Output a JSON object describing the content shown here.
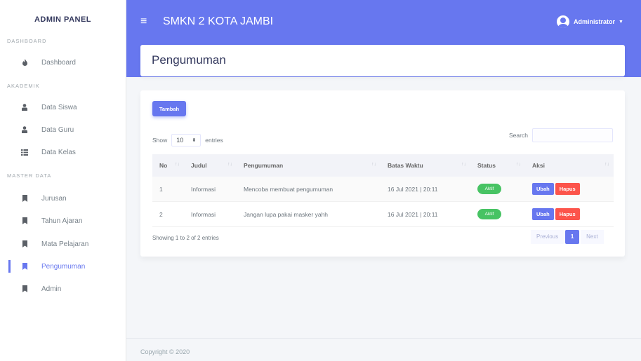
{
  "sidebar": {
    "brand": "ADMIN PANEL",
    "sections": [
      "DASHBOARD",
      "AKADEMIK",
      "MASTER DATA"
    ],
    "items": [
      {
        "label": "Dashboard",
        "icon": "fire-icon"
      },
      {
        "label": "Data Siswa",
        "icon": "user-icon"
      },
      {
        "label": "Data Guru",
        "icon": "user-icon"
      },
      {
        "label": "Data Kelas",
        "icon": "list-icon"
      },
      {
        "label": "Jurusan",
        "icon": "bookmark-icon"
      },
      {
        "label": "Tahun Ajaran",
        "icon": "bookmark-icon"
      },
      {
        "label": "Mata Pelajaran",
        "icon": "bookmark-icon"
      },
      {
        "label": "Pengumuman",
        "icon": "bookmark-icon",
        "active": true
      },
      {
        "label": "Admin",
        "icon": "bookmark-icon"
      }
    ]
  },
  "header": {
    "menu_icon": "≡",
    "title": "SMKN 2 KOTA JAMBI",
    "user": "Administrator"
  },
  "page": {
    "title": "Pengumuman"
  },
  "table_controls": {
    "add_label": "Tambah",
    "show_label": "Show",
    "entries_value": "10",
    "entries_label": "entries",
    "search_label": "Search"
  },
  "table": {
    "columns": [
      "No",
      "Judul",
      "Pengumuman",
      "Batas Waktu",
      "Status",
      "Aksi"
    ],
    "rows": [
      {
        "no": "1",
        "judul": "Informasi",
        "pengumuman": "Mencoba membuat pengumuman",
        "batas_waktu": "16 Jul 2021 | 20:11",
        "status": "Aktif"
      },
      {
        "no": "2",
        "judul": "Informasi",
        "pengumuman": "Jangan lupa pakai masker yahh",
        "batas_waktu": "16 Jul 2021 | 20:11",
        "status": "Aktif"
      }
    ],
    "edit_label": "Ubah",
    "delete_label": "Hapus",
    "info": "Showing 1 to 2 of 2 entries"
  },
  "pagination": {
    "previous": "Previous",
    "current": "1",
    "next": "Next"
  },
  "footer": {
    "text": "Copyright © 2020"
  },
  "colors": {
    "primary": "#6777ef",
    "success": "#47c363",
    "danger": "#fc544b"
  }
}
